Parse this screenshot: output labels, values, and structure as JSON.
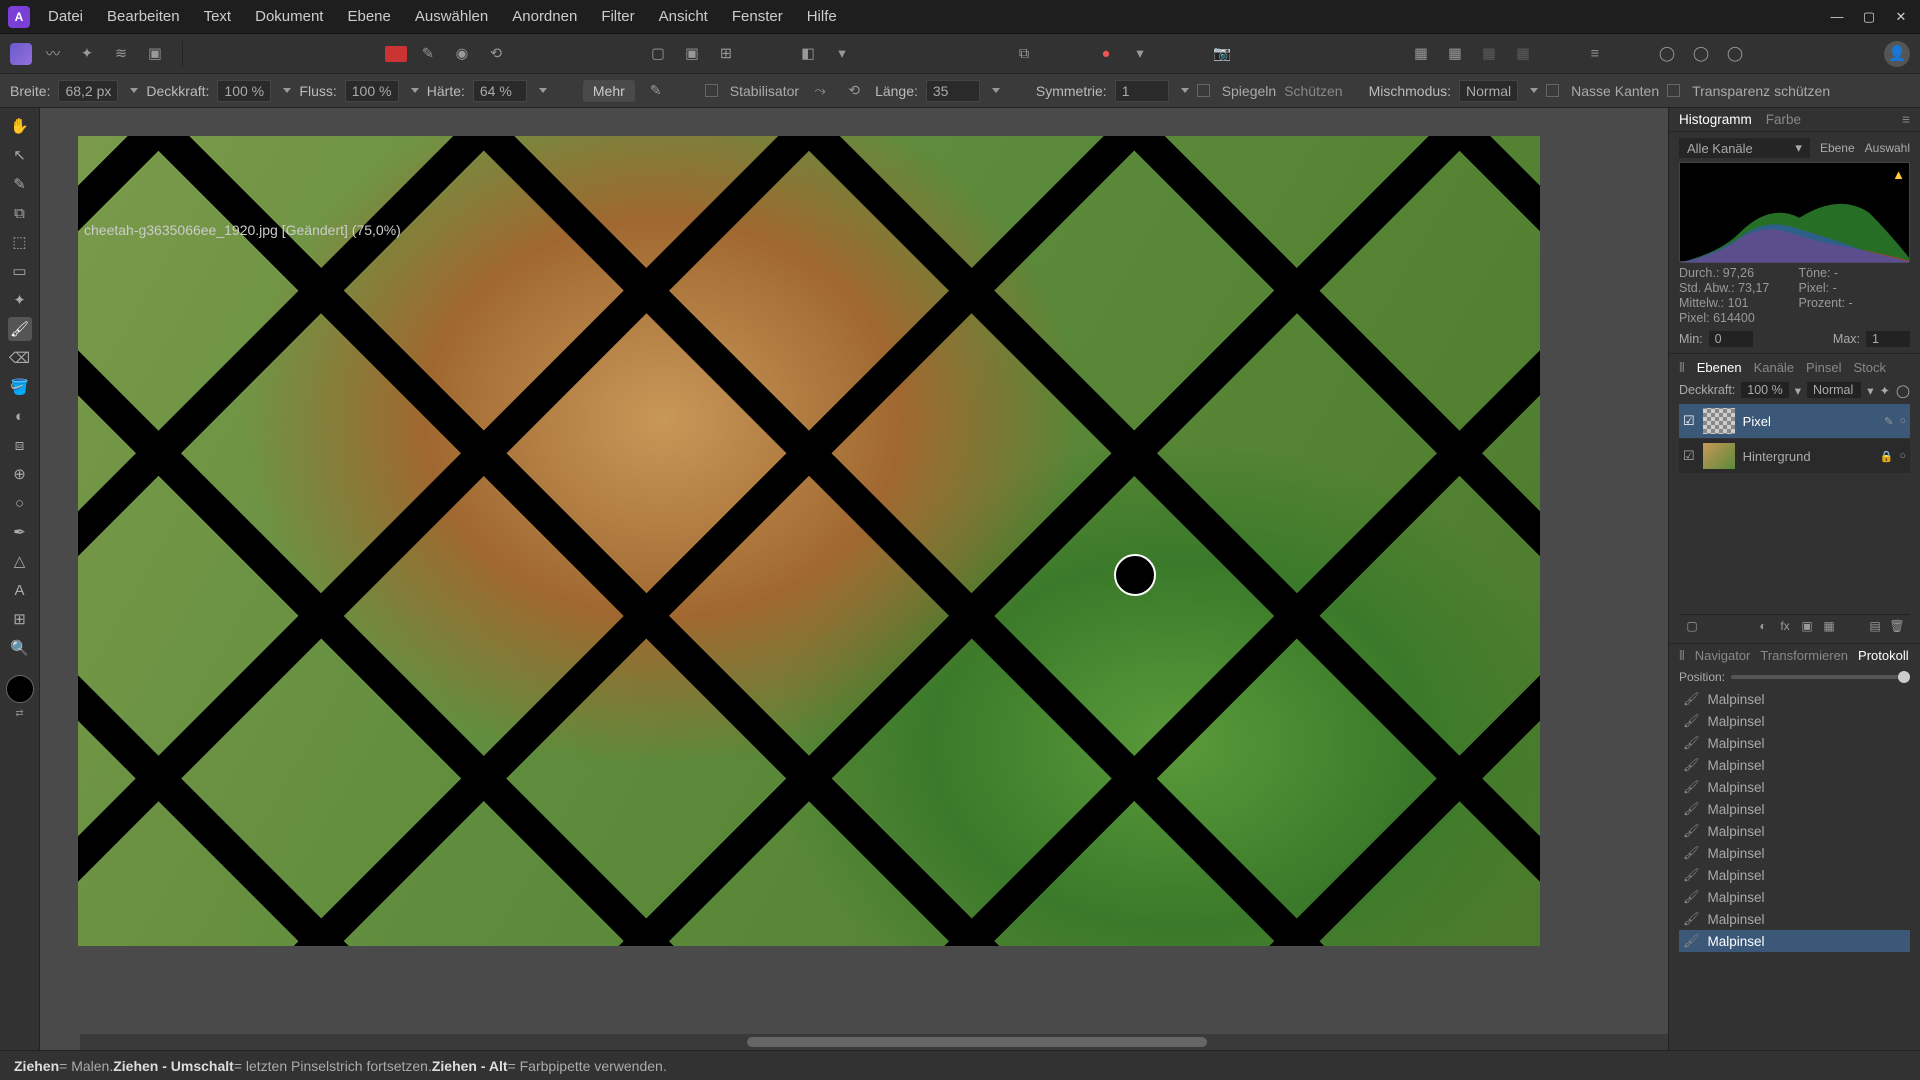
{
  "menu": {
    "file": "Datei",
    "edit": "Bearbeiten",
    "text": "Text",
    "document": "Dokument",
    "layer": "Ebene",
    "select": "Auswählen",
    "arrange": "Anordnen",
    "filter": "Filter",
    "view": "Ansicht",
    "window": "Fenster",
    "help": "Hilfe"
  },
  "doc": {
    "title": "cheetah-g3635066ee_1920.jpg [Geändert] (75,0%)"
  },
  "ctx": {
    "width_label": "Breite:",
    "width": "68,2 px",
    "opacity_label": "Deckkraft:",
    "opacity": "100 %",
    "flow_label": "Fluss:",
    "flow": "100 %",
    "hardness_label": "Härte:",
    "hardness": "64 %",
    "more": "Mehr",
    "stabilizer": "Stabilisator",
    "length_label": "Länge:",
    "length": "35",
    "symmetry_label": "Symmetrie:",
    "symmetry": "1",
    "mirror": "Spiegeln",
    "protect": "Schützen",
    "blend_label": "Mischmodus:",
    "blend": "Normal",
    "wet": "Nasse Kanten",
    "alpha": "Transparenz schützen"
  },
  "histogram": {
    "tab1": "Histogramm",
    "tab2": "Farbe",
    "channels": "Alle Kanäle",
    "btn_layer": "Ebene",
    "btn_sel": "Auswahl",
    "stats": {
      "mean_l": "Durch.:",
      "mean": "97,26",
      "tone_l": "Töne:",
      "tone": "-",
      "std_l": "Std. Abw.:",
      "std": "73,17",
      "pixel_l": "Pixel:",
      "pixel": "-",
      "median_l": "Mittelw.:",
      "median": "101",
      "percent_l": "Prozent:",
      "percent": "-",
      "px_l": "Pixel:",
      "px": "614400"
    },
    "min_l": "Min:",
    "min": "0",
    "max_l": "Max:",
    "max": "1"
  },
  "layers": {
    "tabs": {
      "layers": "Ebenen",
      "channels": "Kanäle",
      "brush": "Pinsel",
      "stock": "Stock"
    },
    "opacity_l": "Deckkraft:",
    "opacity": "100 %",
    "blend": "Normal",
    "items": [
      {
        "name": "Pixel",
        "sel": true,
        "thumb": "checker"
      },
      {
        "name": "Hintergrund",
        "sel": false,
        "thumb": "img"
      }
    ]
  },
  "history": {
    "tabs": {
      "nav": "Navigator",
      "transform": "Transformieren",
      "protocol": "Protokoll"
    },
    "pos_l": "Position:",
    "items": [
      "Malpinsel",
      "Malpinsel",
      "Malpinsel",
      "Malpinsel",
      "Malpinsel",
      "Malpinsel",
      "Malpinsel",
      "Malpinsel",
      "Malpinsel",
      "Malpinsel",
      "Malpinsel",
      "Malpinsel"
    ]
  },
  "status": {
    "drag": "Ziehen",
    "drag_t": " = Malen. ",
    "shift": "Ziehen - Umschalt",
    "shift_t": " = letzten Pinselstrich fortsetzen. ",
    "alt": "Ziehen - Alt",
    "alt_t": " = Farbpipette verwenden."
  }
}
